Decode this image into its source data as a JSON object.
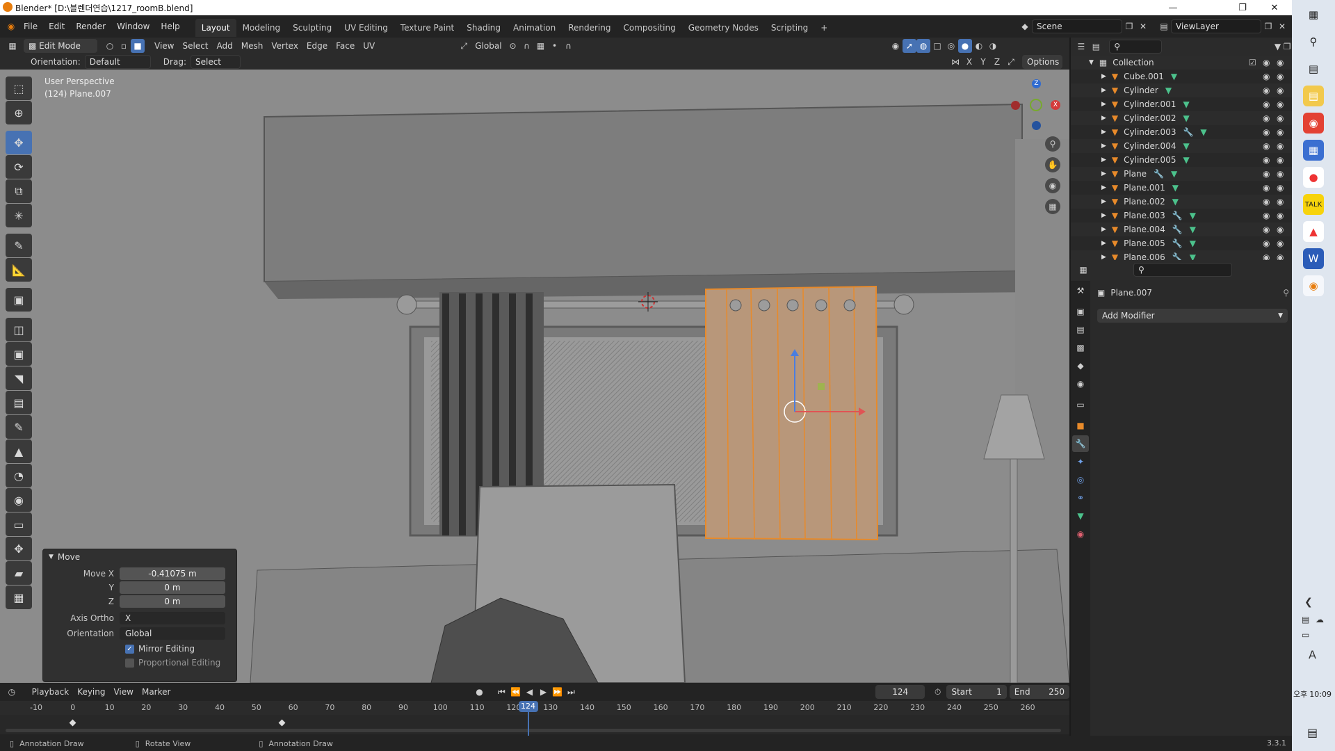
{
  "title_bar": {
    "title": "Blender* [D:\\블렌더연습\\1217_roomB.blend]"
  },
  "menus": [
    "File",
    "Edit",
    "Render",
    "Window",
    "Help"
  ],
  "workspaces": [
    "Layout",
    "Modeling",
    "Sculpting",
    "UV Editing",
    "Texture Paint",
    "Shading",
    "Animation",
    "Rendering",
    "Compositing",
    "Geometry Nodes",
    "Scripting"
  ],
  "active_workspace": "Layout",
  "scene_name": "Scene",
  "view_layer": "ViewLayer",
  "viewport_header": {
    "mode": "Edit Mode",
    "menus": [
      "View",
      "Select",
      "Add",
      "Mesh",
      "Vertex",
      "Edge",
      "Face",
      "UV"
    ],
    "transform_orientation": "Global"
  },
  "tool_settings": {
    "orientation_label": "Orientation:",
    "orientation_value": "Default",
    "drag_label": "Drag:",
    "drag_value": "Select Box",
    "axes": [
      "X",
      "Y",
      "Z"
    ],
    "options_label": "Options"
  },
  "viewport": {
    "perspective": "User Perspective",
    "object_info": "(124) Plane.007",
    "gizmo_axes": {
      "x": "X",
      "z": "Z"
    }
  },
  "operator_panel": {
    "title": "Move",
    "move_x_label": "Move X",
    "move_x": "-0.41075 m",
    "y_label": "Y",
    "y": "0 m",
    "z_label": "Z",
    "z": "0 m",
    "axis_ortho_label": "Axis Ortho",
    "axis_ortho": "X",
    "orientation_label": "Orientation",
    "orientation": "Global",
    "mirror_editing": "Mirror Editing",
    "mirror_editing_checked": true,
    "proportional_editing": "Proportional Editing",
    "proportional_editing_checked": false
  },
  "timeline": {
    "menus": [
      "Playback",
      "Keying",
      "View",
      "Marker"
    ],
    "current_frame": "124",
    "start_label": "Start",
    "start": "1",
    "end_label": "End",
    "end": "250",
    "ruler_labels": [
      "-10",
      "0",
      "10",
      "20",
      "30",
      "40",
      "50",
      "60",
      "70",
      "80",
      "90",
      "100",
      "110",
      "120",
      "130",
      "140",
      "150",
      "160",
      "170",
      "180",
      "190",
      "200",
      "210",
      "220",
      "230",
      "240",
      "250",
      "260"
    ]
  },
  "outliner": {
    "collection": "Collection",
    "items": [
      {
        "name": "Cube.001",
        "modifier": false
      },
      {
        "name": "Cylinder",
        "modifier": false
      },
      {
        "name": "Cylinder.001",
        "modifier": false
      },
      {
        "name": "Cylinder.002",
        "modifier": false
      },
      {
        "name": "Cylinder.003",
        "modifier": true
      },
      {
        "name": "Cylinder.004",
        "modifier": false
      },
      {
        "name": "Cylinder.005",
        "modifier": false
      },
      {
        "name": "Plane",
        "modifier": true
      },
      {
        "name": "Plane.001",
        "modifier": false
      },
      {
        "name": "Plane.002",
        "modifier": false
      },
      {
        "name": "Plane.003",
        "modifier": true
      },
      {
        "name": "Plane.004",
        "modifier": true
      },
      {
        "name": "Plane.005",
        "modifier": true
      },
      {
        "name": "Plane.006",
        "modifier": true
      }
    ]
  },
  "properties": {
    "object_name": "Plane.007",
    "add_modifier": "Add Modifier"
  },
  "status_bar": {
    "left": "Annotation Draw",
    "middle": "Rotate View",
    "right": "Annotation Draw",
    "version": "3.3.1"
  },
  "taskbar": {
    "time_period": "오후",
    "time": "10:09",
    "ime": "A"
  },
  "colors": {
    "accent": "#4772b3",
    "selected_orange": "#e88a2a",
    "viewport_bg": "#8e8e8e"
  }
}
